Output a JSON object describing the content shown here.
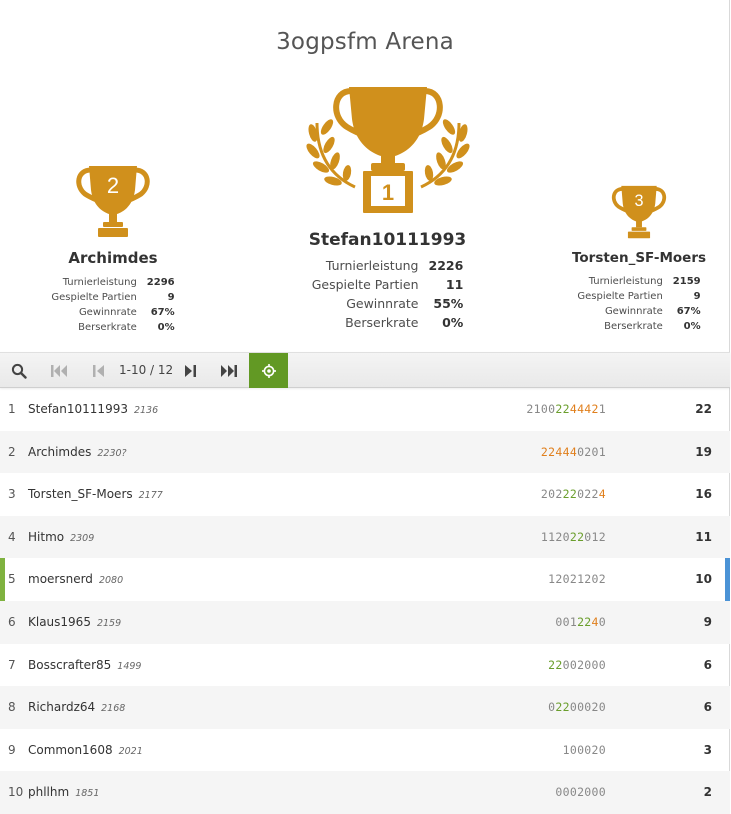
{
  "title": "3ogpsfm Arena",
  "colors": {
    "gold": "#D0901C",
    "green": "#629924",
    "blue": "#4B93D6",
    "streak": "#E07F1C"
  },
  "podium": {
    "first": {
      "rank": "1",
      "name": "Stefan10111993",
      "stats": [
        {
          "label": "Turnierleistung",
          "value": "2226"
        },
        {
          "label": "Gespielte Partien",
          "value": "11"
        },
        {
          "label": "Gewinnrate",
          "value": "55%"
        },
        {
          "label": "Berserkrate",
          "value": "0%"
        }
      ]
    },
    "second": {
      "rank": "2",
      "name": "Archimdes",
      "stats": [
        {
          "label": "Turnierleistung",
          "value": "2296"
        },
        {
          "label": "Gespielte Partien",
          "value": "9"
        },
        {
          "label": "Gewinnrate",
          "value": "67%"
        },
        {
          "label": "Berserkrate",
          "value": "0%"
        }
      ]
    },
    "third": {
      "rank": "3",
      "name": "Torsten_SF-Moers",
      "stats": [
        {
          "label": "Turnierleistung",
          "value": "2159"
        },
        {
          "label": "Gespielte Partien",
          "value": "9"
        },
        {
          "label": "Gewinnrate",
          "value": "67%"
        },
        {
          "label": "Berserkrate",
          "value": "0%"
        }
      ]
    }
  },
  "toolbar": {
    "pager": "1-10 / 12",
    "icons": [
      "search-icon",
      "first-page-icon",
      "previous-page-icon",
      "next-page-icon",
      "last-page-icon",
      "crosshair-icon"
    ]
  },
  "standings": [
    {
      "rank": "1",
      "name": "Stefan10111993",
      "rating": "2136",
      "sheet": [
        [
          "2",
          ""
        ],
        [
          "1",
          ""
        ],
        [
          "0",
          ""
        ],
        [
          "0",
          ""
        ],
        [
          "2",
          "w"
        ],
        [
          "2",
          "w"
        ],
        [
          "4",
          "s"
        ],
        [
          "4",
          "s"
        ],
        [
          "4",
          "s"
        ],
        [
          "2",
          "s"
        ],
        [
          "1",
          ""
        ]
      ],
      "score": "22",
      "me": false
    },
    {
      "rank": "2",
      "name": "Archimdes",
      "rating": "2230?",
      "sheet": [
        [
          "2",
          "s"
        ],
        [
          "2",
          "s"
        ],
        [
          "4",
          "s"
        ],
        [
          "4",
          "s"
        ],
        [
          "4",
          "s"
        ],
        [
          "0",
          ""
        ],
        [
          "2",
          ""
        ],
        [
          "0",
          ""
        ],
        [
          "1",
          ""
        ]
      ],
      "score": "19",
      "me": false
    },
    {
      "rank": "3",
      "name": "Torsten_SF-Moers",
      "rating": "2177",
      "sheet": [
        [
          "2",
          ""
        ],
        [
          "0",
          ""
        ],
        [
          "2",
          ""
        ],
        [
          "2",
          "w"
        ],
        [
          "2",
          "w"
        ],
        [
          "0",
          ""
        ],
        [
          "2",
          ""
        ],
        [
          "2",
          ""
        ],
        [
          "4",
          "s"
        ]
      ],
      "score": "16",
      "me": false
    },
    {
      "rank": "4",
      "name": "Hitmo",
      "rating": "2309",
      "sheet": [
        [
          "1",
          ""
        ],
        [
          "1",
          ""
        ],
        [
          "2",
          ""
        ],
        [
          "0",
          ""
        ],
        [
          "2",
          "w"
        ],
        [
          "2",
          "w"
        ],
        [
          "0",
          ""
        ],
        [
          "1",
          ""
        ],
        [
          "2",
          ""
        ]
      ],
      "score": "11",
      "me": false
    },
    {
      "rank": "5",
      "name": "moersnerd",
      "rating": "2080",
      "sheet": [
        [
          "1",
          ""
        ],
        [
          "2",
          ""
        ],
        [
          "0",
          ""
        ],
        [
          "2",
          ""
        ],
        [
          "1",
          ""
        ],
        [
          "2",
          ""
        ],
        [
          "0",
          ""
        ],
        [
          "2",
          ""
        ]
      ],
      "score": "10",
      "me": true
    },
    {
      "rank": "6",
      "name": "Klaus1965",
      "rating": "2159",
      "sheet": [
        [
          "0",
          ""
        ],
        [
          "0",
          ""
        ],
        [
          "1",
          ""
        ],
        [
          "2",
          "w"
        ],
        [
          "2",
          "w"
        ],
        [
          "4",
          "s"
        ],
        [
          "0",
          ""
        ]
      ],
      "score": "9",
      "me": false
    },
    {
      "rank": "7",
      "name": "Bosscrafter85",
      "rating": "1499",
      "sheet": [
        [
          "2",
          "w"
        ],
        [
          "2",
          "w"
        ],
        [
          "0",
          ""
        ],
        [
          "0",
          ""
        ],
        [
          "2",
          ""
        ],
        [
          "0",
          ""
        ],
        [
          "0",
          ""
        ],
        [
          "0",
          ""
        ]
      ],
      "score": "6",
      "me": false
    },
    {
      "rank": "8",
      "name": "Richardz64",
      "rating": "2168",
      "sheet": [
        [
          "0",
          ""
        ],
        [
          "2",
          "w"
        ],
        [
          "2",
          "w"
        ],
        [
          "0",
          ""
        ],
        [
          "0",
          ""
        ],
        [
          "0",
          ""
        ],
        [
          "2",
          ""
        ],
        [
          "0",
          ""
        ]
      ],
      "score": "6",
      "me": false
    },
    {
      "rank": "9",
      "name": "Common1608",
      "rating": "2021",
      "sheet": [
        [
          "1",
          ""
        ],
        [
          "0",
          ""
        ],
        [
          "0",
          ""
        ],
        [
          "0",
          ""
        ],
        [
          "2",
          ""
        ],
        [
          "0",
          ""
        ]
      ],
      "score": "3",
      "me": false
    },
    {
      "rank": "10",
      "name": "phllhm",
      "rating": "1851",
      "sheet": [
        [
          "0",
          ""
        ],
        [
          "0",
          ""
        ],
        [
          "0",
          ""
        ],
        [
          "2",
          ""
        ],
        [
          "0",
          ""
        ],
        [
          "0",
          ""
        ],
        [
          "0",
          ""
        ]
      ],
      "score": "2",
      "me": false
    }
  ]
}
